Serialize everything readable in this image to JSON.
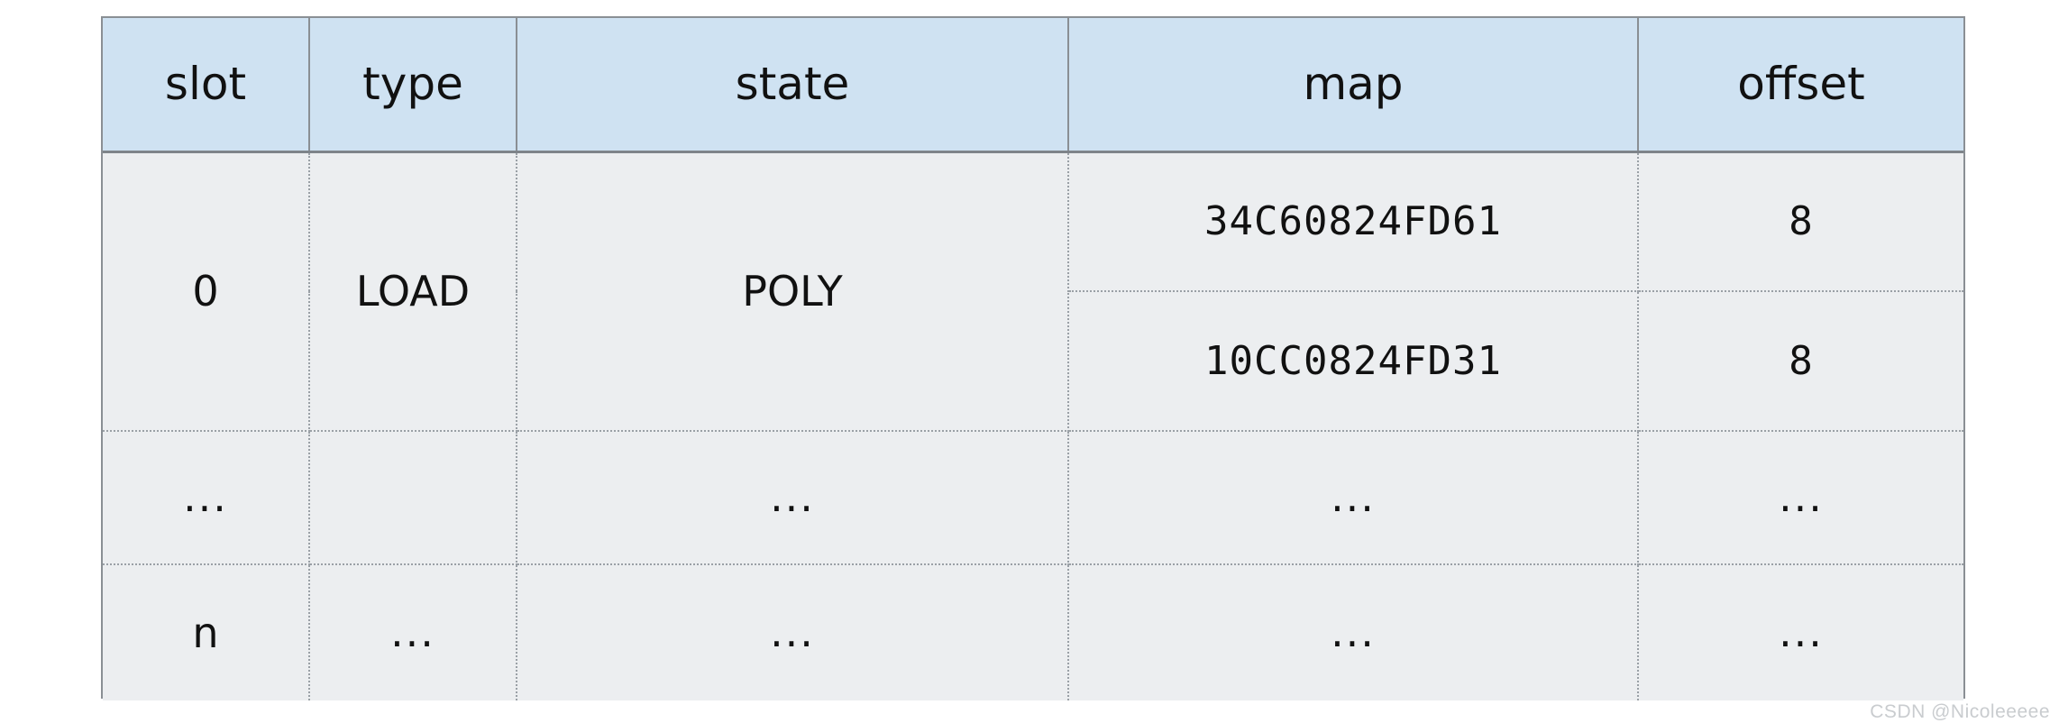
{
  "table": {
    "columns": [
      {
        "key": "slot",
        "label": "slot"
      },
      {
        "key": "type",
        "label": "type"
      },
      {
        "key": "state",
        "label": "state"
      },
      {
        "key": "map",
        "label": "map"
      },
      {
        "key": "offset",
        "label": "offset"
      }
    ],
    "rows": [
      {
        "slot": "0",
        "type": "LOAD",
        "state": "POLY",
        "entries": [
          {
            "map": "34C60824FD61",
            "offset": "8"
          },
          {
            "map": "10CC0824FD31",
            "offset": "8"
          }
        ]
      },
      {
        "slot": "...",
        "type": "",
        "state": "...",
        "entries": [
          {
            "map": "...",
            "offset": "..."
          }
        ]
      },
      {
        "slot": "n",
        "type": "...",
        "state": "...",
        "entries": [
          {
            "map": "...",
            "offset": "..."
          }
        ]
      }
    ]
  },
  "watermark": {
    "text": "CSDN @Nicoleeeee"
  },
  "colors": {
    "header_background": "#cfe2f2",
    "body_background": "#eceef0",
    "border": "#8a8f94",
    "dotted_border": "#9aa0a6",
    "text": "#111111",
    "watermark_text": "#c9cccf"
  }
}
